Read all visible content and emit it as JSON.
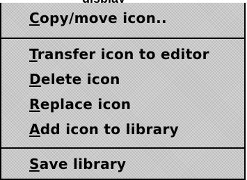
{
  "window_title": "display",
  "menu": {
    "items": [
      {
        "mnemonic": "C",
        "rest": "opy/move icon.."
      },
      {
        "mnemonic": "T",
        "rest": "ransfer icon to editor"
      },
      {
        "mnemonic": "D",
        "rest": "elete icon"
      },
      {
        "mnemonic": "R",
        "rest": "eplace icon"
      },
      {
        "mnemonic": "A",
        "rest": "dd icon to library"
      },
      {
        "mnemonic": "S",
        "rest": "ave library"
      }
    ]
  }
}
